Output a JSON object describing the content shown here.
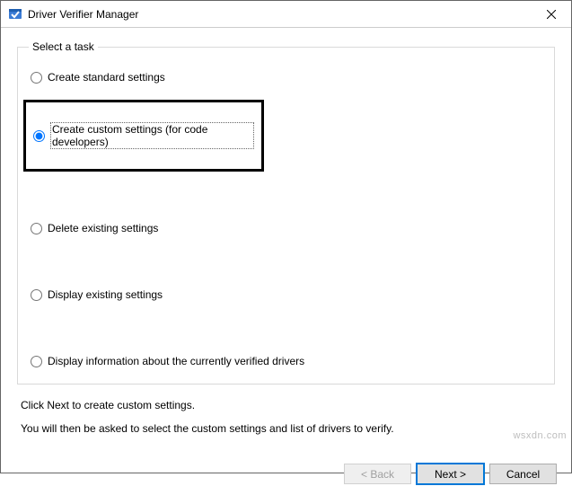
{
  "window": {
    "title": "Driver Verifier Manager"
  },
  "group": {
    "legend": "Select a task"
  },
  "options": {
    "create_standard": "Create standard settings",
    "create_custom": "Create custom settings (for code developers)",
    "delete_existing": "Delete existing settings",
    "display_existing": "Display existing settings",
    "display_info": "Display information about the currently verified drivers"
  },
  "selected": "create_custom",
  "info": {
    "line1": "Click Next to create custom settings.",
    "line2": "You will then be asked to select the custom settings and list of drivers to verify."
  },
  "buttons": {
    "back": "< Back",
    "next": "Next >",
    "cancel": "Cancel"
  },
  "watermark": "wsxdn.com"
}
